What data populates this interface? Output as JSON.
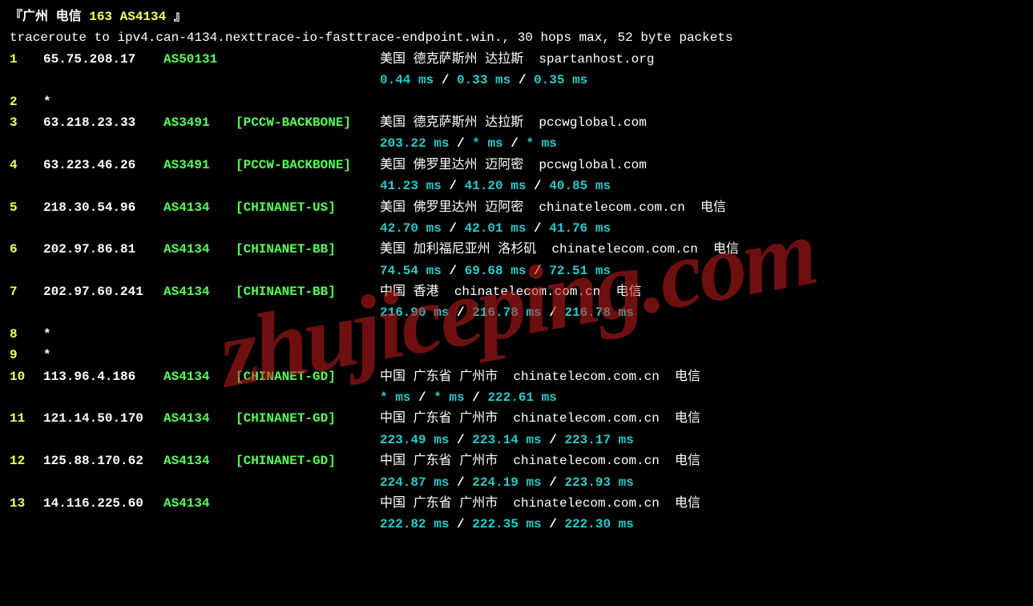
{
  "header": {
    "prefix": "『广州 电信 ",
    "highlight": "163 AS4134",
    "suffix": " 』"
  },
  "subheader": "traceroute to ipv4.can-4134.nexttrace-io-fasttrace-endpoint.win., 30 hops max, 52 byte packets",
  "watermark": "zhujiceping.com",
  "hops": [
    {
      "n": "1",
      "ip": "65.75.208.17",
      "asn": "AS50131",
      "net": "",
      "loc": "美国 德克萨斯州 达拉斯 ",
      "org": " spartanhost.org",
      "isp": "",
      "l1": "0.44 ms",
      "l2": "0.33 ms",
      "l3": "0.35 ms"
    },
    {
      "n": "2",
      "star": true
    },
    {
      "n": "3",
      "ip": "63.218.23.33",
      "asn": "AS3491",
      "net": "[PCCW-BACKBONE]",
      "loc": "美国 德克萨斯州 达拉斯 ",
      "org": " pccwglobal.com",
      "isp": "",
      "l1": "203.22 ms",
      "l2": "* ms",
      "l3": "* ms"
    },
    {
      "n": "4",
      "ip": "63.223.46.26",
      "asn": "AS3491",
      "net": "[PCCW-BACKBONE]",
      "loc": "美国 佛罗里达州 迈阿密 ",
      "org": " pccwglobal.com",
      "isp": "",
      "l1": "41.23 ms",
      "l2": "41.20 ms",
      "l3": "40.85 ms"
    },
    {
      "n": "5",
      "ip": "218.30.54.96",
      "asn": "AS4134",
      "net": "[CHINANET-US]",
      "loc": "美国 佛罗里达州 迈阿密 ",
      "org": " chinatelecom.com.cn ",
      "isp": " 电信",
      "l1": "42.70 ms",
      "l2": "42.01 ms",
      "l3": "41.76 ms"
    },
    {
      "n": "6",
      "ip": "202.97.86.81",
      "asn": "AS4134",
      "net": "[CHINANET-BB]",
      "loc": "美国 加利福尼亚州 洛杉矶 ",
      "org": " chinatelecom.com.cn ",
      "isp": " 电信",
      "l1": "74.54 ms",
      "l2": "69.68 ms",
      "l3": "72.51 ms"
    },
    {
      "n": "7",
      "ip": "202.97.60.241",
      "asn": "AS4134",
      "net": "[CHINANET-BB]",
      "loc": "中国 香港 ",
      "org": " chinatelecom.com.cn ",
      "isp": " 电信",
      "l1": "216.90 ms",
      "l2": "216.78 ms",
      "l3": "216.78 ms"
    },
    {
      "n": "8",
      "star": true
    },
    {
      "n": "9",
      "star": true
    },
    {
      "n": "10",
      "ip": "113.96.4.186",
      "asn": "AS4134",
      "net": "[CHINANET-GD]",
      "loc": "中国 广东省 广州市 ",
      "org": " chinatelecom.com.cn ",
      "isp": " 电信",
      "l1": "* ms",
      "l2": "* ms",
      "l3": "222.61 ms"
    },
    {
      "n": "11",
      "ip": "121.14.50.170",
      "asn": "AS4134",
      "net": "[CHINANET-GD]",
      "loc": "中国 广东省 广州市 ",
      "org": " chinatelecom.com.cn ",
      "isp": " 电信",
      "l1": "223.49 ms",
      "l2": "223.14 ms",
      "l3": "223.17 ms"
    },
    {
      "n": "12",
      "ip": "125.88.170.62",
      "asn": "AS4134",
      "net": "[CHINANET-GD]",
      "loc": "中国 广东省 广州市 ",
      "org": " chinatelecom.com.cn ",
      "isp": " 电信",
      "l1": "224.87 ms",
      "l2": "224.19 ms",
      "l3": "223.93 ms"
    },
    {
      "n": "13",
      "ip": "14.116.225.60",
      "asn": "AS4134",
      "net": "",
      "loc": "中国 广东省 广州市 ",
      "org": " chinatelecom.com.cn ",
      "isp": " 电信",
      "l1": "222.82 ms",
      "l2": "222.35 ms",
      "l3": "222.30 ms"
    }
  ]
}
